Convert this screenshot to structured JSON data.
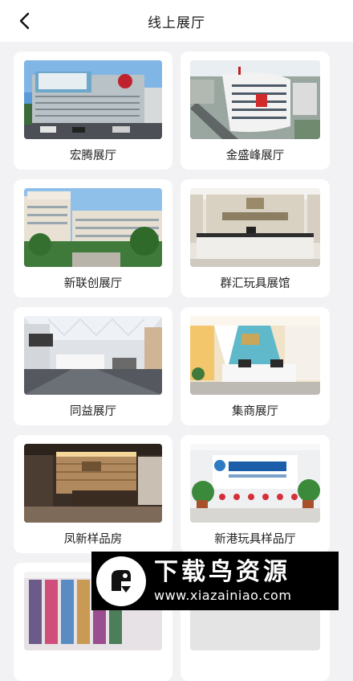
{
  "header": {
    "title": "线上展厅",
    "back_icon": "chevron-left-icon"
  },
  "showrooms": [
    {
      "name": "宏腾展厅"
    },
    {
      "name": "金盛峰展厅"
    },
    {
      "name": "新联创展厅"
    },
    {
      "name": "群汇玩具展馆"
    },
    {
      "name": "同益展厅"
    },
    {
      "name": "集商展厅"
    },
    {
      "name": "凤新样品房"
    },
    {
      "name": "新港玩具样品厅"
    },
    {
      "name": ""
    },
    {
      "name": ""
    }
  ],
  "watermark": {
    "title": "下载鸟资源",
    "url": "www.xiazainiao.com"
  }
}
